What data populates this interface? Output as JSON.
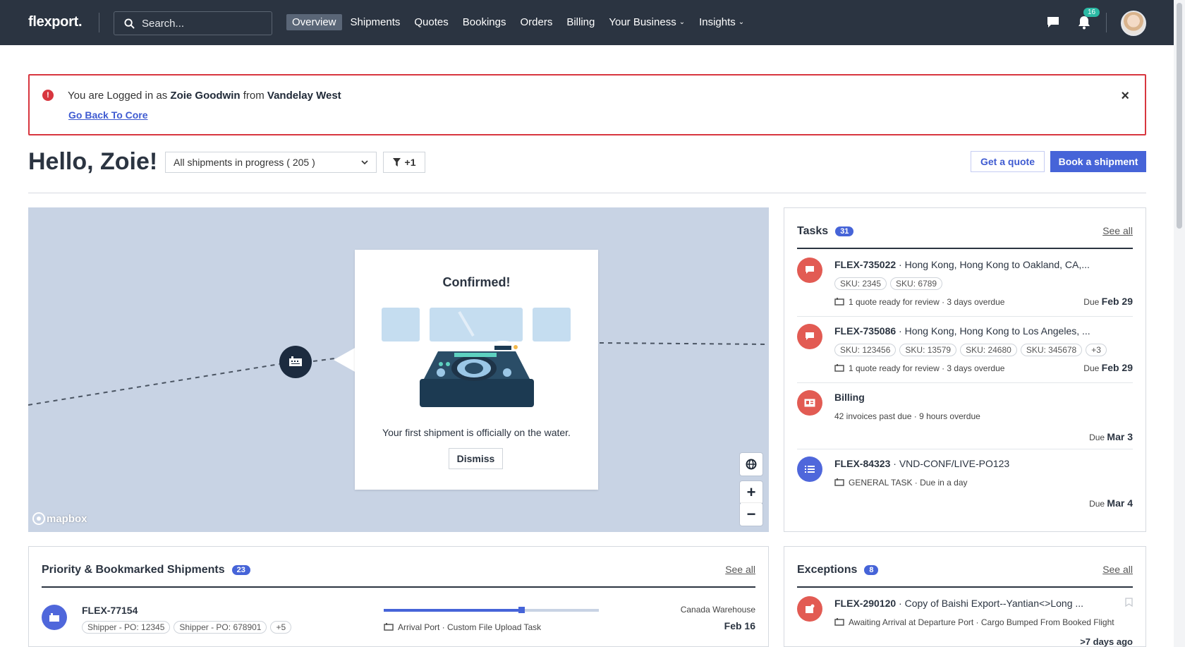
{
  "nav": {
    "logo": "flexport.",
    "search_placeholder": "Search...",
    "items": [
      {
        "label": "Overview",
        "active": true
      },
      {
        "label": "Shipments"
      },
      {
        "label": "Quotes"
      },
      {
        "label": "Bookings"
      },
      {
        "label": "Orders"
      },
      {
        "label": "Billing"
      },
      {
        "label": "Your Business",
        "dropdown": true
      },
      {
        "label": "Insights",
        "dropdown": true
      }
    ],
    "notifications_count": "16"
  },
  "alert": {
    "prefix": "You are Logged in as",
    "user": "Zoie Goodwin",
    "middle": "from",
    "company": "Vandelay West",
    "link": "Go Back To Core",
    "close": "×"
  },
  "header": {
    "greeting": "Hello, Zoie!",
    "filter_select": "All shipments in progress ( 205 )",
    "filter_button": "+1",
    "get_quote": "Get a quote",
    "book_shipment": "Book a shipment"
  },
  "map": {
    "popup_title": "Confirmed!",
    "popup_message": "Your first shipment is officially on the water.",
    "dismiss": "Dismiss",
    "attribution": "mapbox",
    "zoom_in": "+",
    "zoom_out": "−"
  },
  "tasks": {
    "title": "Tasks",
    "count": "31",
    "see_all": "See all",
    "items": [
      {
        "id": "FLEX-735022",
        "route": " · Hong Kong, Hong Kong to Oakland, CA,...",
        "tags": [
          "SKU: 2345",
          "SKU: 6789"
        ],
        "meta": "1 quote ready for review · 3 days overdue",
        "due_label": "Due",
        "due_date": "Feb 29",
        "icon": "chat-icon",
        "color": "#e25b53"
      },
      {
        "id": "FLEX-735086",
        "route": " · Hong Kong, Hong Kong to Los Angeles, ...",
        "tags": [
          "SKU: 123456",
          "SKU: 13579",
          "SKU: 24680",
          "SKU: 345678",
          "+3"
        ],
        "meta": "1 quote ready for review · 3 days overdue",
        "due_label": "Due",
        "due_date": "Feb 29",
        "icon": "chat-icon",
        "color": "#e25b53"
      },
      {
        "id": "Billing",
        "route": "",
        "meta": "42 invoices past due · 9 hours overdue",
        "due_label": "Due",
        "due_date": "Mar 3",
        "icon": "invoice-icon",
        "color": "#e25b53"
      },
      {
        "id": "FLEX-84323",
        "route": " · VND-CONF/LIVE-PO123",
        "meta": "GENERAL TASK · Due in a day",
        "due_label": "Due",
        "due_date": "Mar 4",
        "icon": "list-icon",
        "color": "#4f67db"
      }
    ]
  },
  "priority": {
    "title": "Priority & Bookmarked Shipments",
    "count": "23",
    "see_all": "See all",
    "shipment": {
      "id": "FLEX-77154",
      "tags": [
        "Shipper - PO: 12345",
        "Shipper - PO: 678901",
        "+5"
      ],
      "progress": 0.64,
      "meta": "Arrival Port · Custom File Upload Task",
      "destination": "Canada Warehouse",
      "date": "Feb 16"
    }
  },
  "exceptions": {
    "title": "Exceptions",
    "count": "8",
    "see_all": "See all",
    "item": {
      "id": "FLEX-290120",
      "desc": " · Copy of Baishi Export--Yantian<>Long ...",
      "meta": "Awaiting Arrival at Departure Port · Cargo Bumped From Booked Flight",
      "time": ">7 days ago"
    }
  }
}
